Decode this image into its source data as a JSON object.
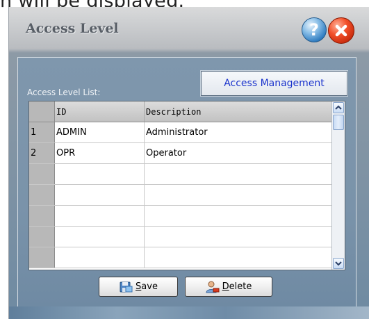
{
  "doc_caption": "n will be displayed.",
  "window": {
    "title": "Access Level",
    "help_glyph": "?"
  },
  "panel": {
    "list_label": "Access Level List:",
    "management_button": "Access Management"
  },
  "grid": {
    "columns": [
      "ID",
      "Description"
    ],
    "rows": [
      {
        "index": "1",
        "id": "ADMIN",
        "description": "Administrator"
      },
      {
        "index": "2",
        "id": "OPR",
        "description": "Operator"
      },
      {
        "index": "",
        "id": "",
        "description": ""
      },
      {
        "index": "",
        "id": "",
        "description": ""
      },
      {
        "index": "",
        "id": "",
        "description": ""
      },
      {
        "index": "",
        "id": "",
        "description": ""
      },
      {
        "index": "",
        "id": "",
        "description": ""
      }
    ]
  },
  "buttons": {
    "save_mnemonic": "S",
    "save_rest": "ave",
    "delete_mnemonic": "D",
    "delete_rest": "elete"
  },
  "icons": {
    "help": "help-icon",
    "close": "close-icon",
    "save": "floppy-disk-icon",
    "delete": "user-delete-icon",
    "scroll_up": "chevron-up-icon",
    "scroll_down": "chevron-down-icon"
  }
}
